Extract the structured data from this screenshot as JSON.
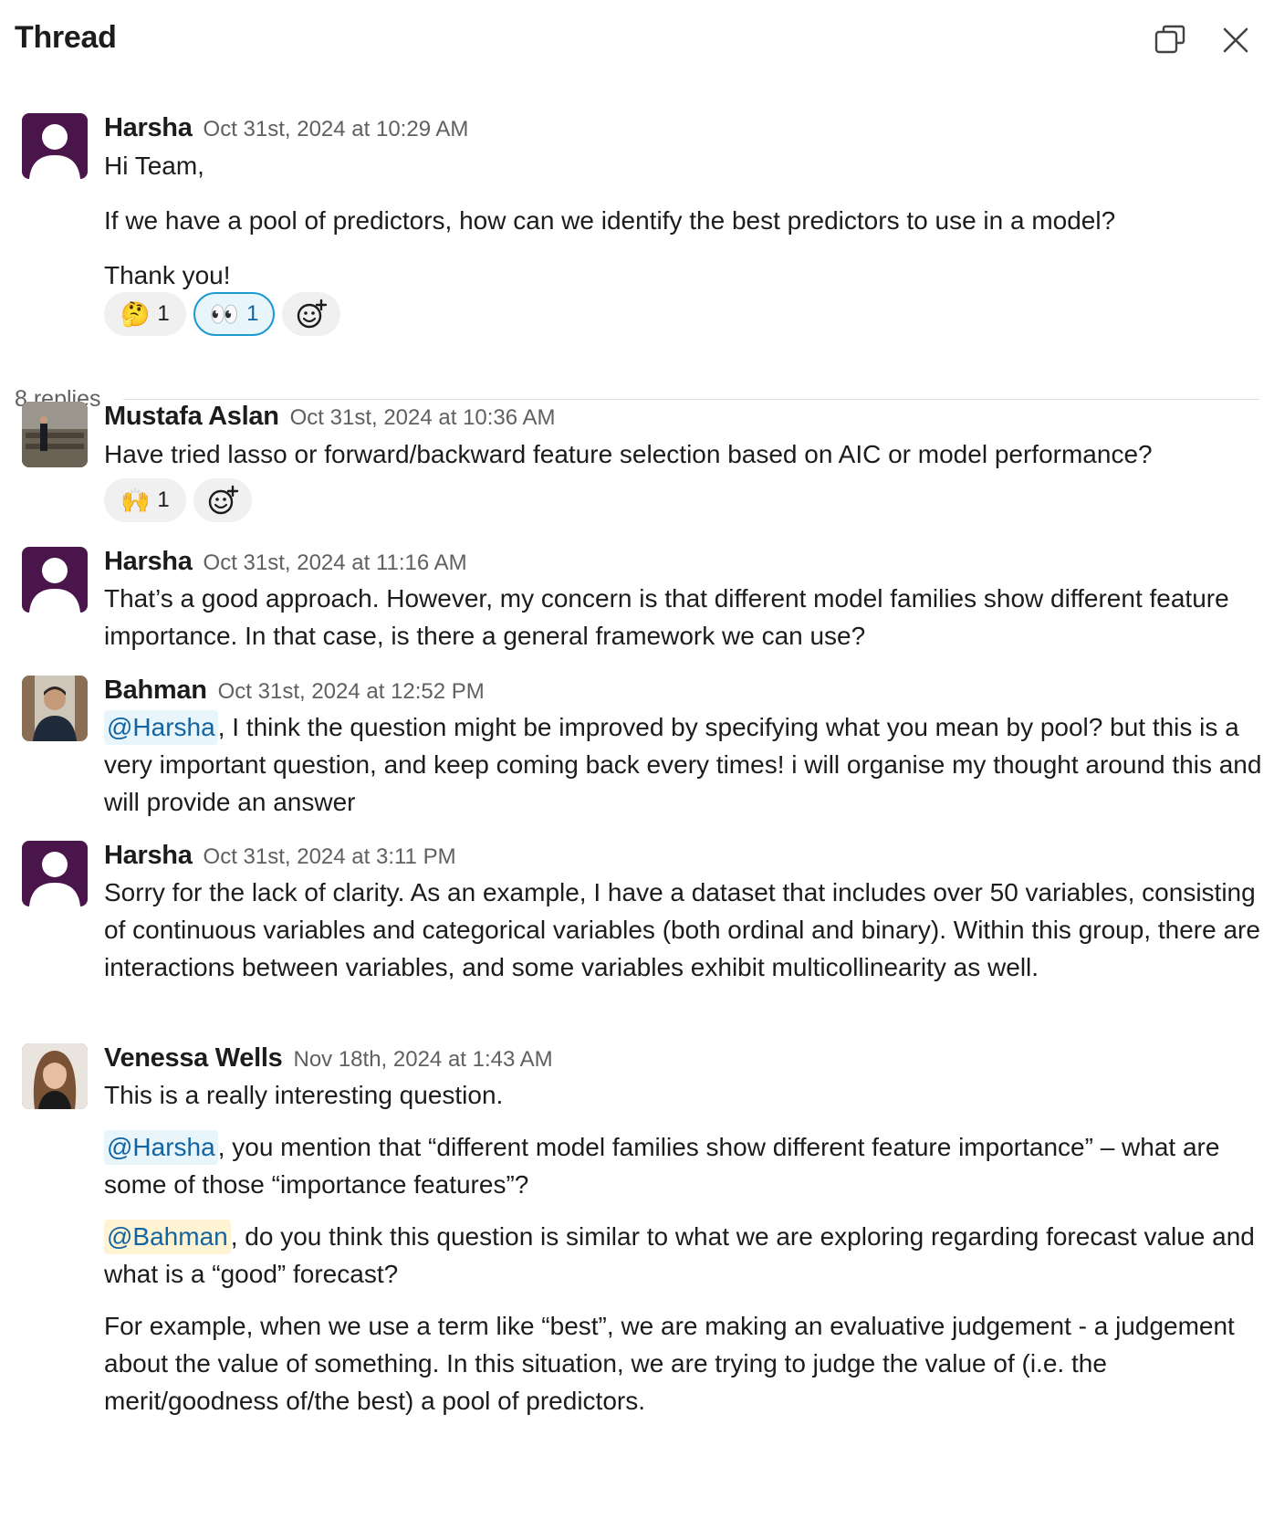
{
  "header": {
    "title": "Thread",
    "popout_icon": "popout-icon",
    "close_icon": "close-icon"
  },
  "replies_label": "8 replies",
  "messages": [
    {
      "author": "Harsha",
      "time": "Oct 31st, 2024 at 10:29 AM",
      "paragraphs": [
        "Hi Team,",
        "If we have a pool of predictors, how can we identify the best predictors to use in a model?",
        "Thank you!"
      ],
      "reactions": [
        {
          "emoji": "🤔",
          "count": "1",
          "active": false
        },
        {
          "emoji": "👀",
          "count": "1",
          "active": true
        }
      ]
    },
    {
      "author": "Mustafa Aslan",
      "time": "Oct 31st, 2024 at 10:36 AM",
      "paragraphs": [
        "Have tried lasso or forward/backward feature selection based on AIC or model performance?"
      ],
      "reactions": [
        {
          "emoji": "🙌",
          "count": "1",
          "active": false
        }
      ]
    },
    {
      "author": "Harsha",
      "time": "Oct 31st, 2024 at 11:16 AM",
      "paragraphs": [
        "That’s a good approach. However, my concern is that different model families show different feature importance. In that case, is there a general framework we can use?"
      ]
    },
    {
      "author": "Bahman",
      "time": "Oct 31st, 2024 at 12:52 PM",
      "mention": "@Harsha",
      "paragraphs": [
        ", I think the question might be improved by specifying what you mean by pool? but this is a very important question, and keep coming back every times! i will organise my thought around this and will provide an answer"
      ]
    },
    {
      "author": "Harsha",
      "time": "Oct 31st, 2024 at 3:11 PM",
      "paragraphs": [
        "Sorry for the lack of clarity. As an example, I have a dataset that includes over 50 variables, consisting of continuous variables and categorical variables (both ordinal and binary). Within this group, there are interactions between variables, and some variables exhibit multicollinearity as well."
      ]
    },
    {
      "author": "Venessa Wells",
      "time": "Nov 18th, 2024 at 1:43 AM",
      "mention_1": "@Harsha",
      "mention_2": "@Bahman",
      "paragraphs": [
        "This is a really interesting question.",
        ", you mention that “different model families show different feature importance” – what are some of those “importance features”?",
        ", do you think this question is similar to what we are exploring regarding forecast value and what is a “good” forecast?",
        "For example, when we use a term like “best”, we are making an evaluative judgement - a judgement about the value of something. In this situation, we are trying to judge the value of (i.e. the merit/goodness of/the best) a pool of predictors."
      ]
    }
  ]
}
